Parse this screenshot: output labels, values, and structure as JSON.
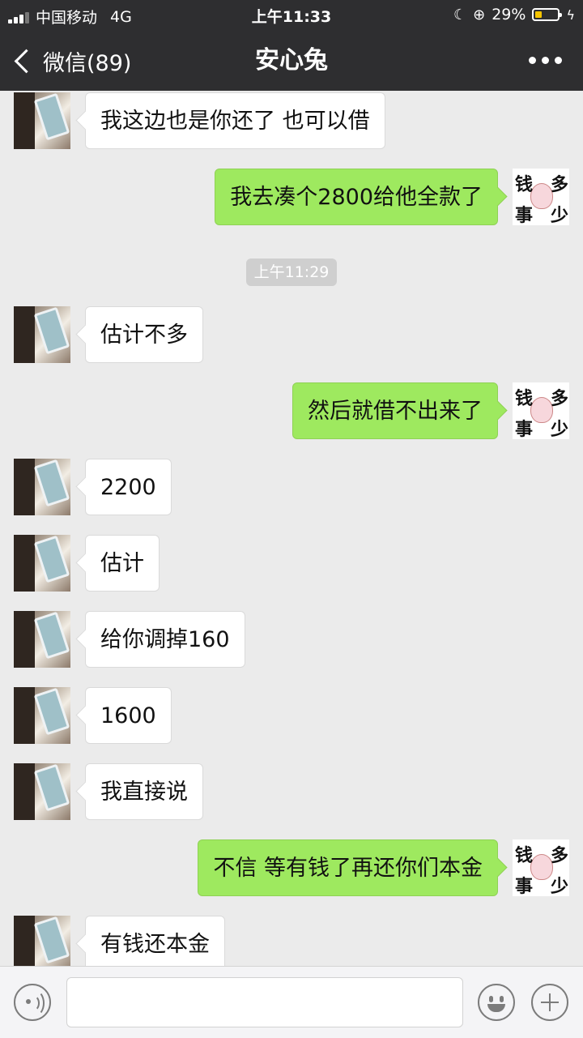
{
  "status_bar": {
    "carrier": "中国移动",
    "network": "4G",
    "time": "上午11:33",
    "battery_percent": "29%",
    "battery_level": 0.29,
    "battery_color": "#f5c400"
  },
  "nav": {
    "back_label": "微信(89)",
    "title": "安心兔",
    "more_icon": "more-dots-icon"
  },
  "chat": {
    "timestamp": "上午11:29",
    "messages": [
      {
        "side": "in",
        "text": "我这边也是你还了 也可以借"
      },
      {
        "side": "out",
        "text": "我去凑个2800给他全款了"
      },
      {
        "side": "in",
        "text": "估计不多"
      },
      {
        "side": "out",
        "text": "然后就借不出来了"
      },
      {
        "side": "in",
        "text": "2200"
      },
      {
        "side": "in",
        "text": "估计"
      },
      {
        "side": "in",
        "text": "给你调掉160"
      },
      {
        "side": "in",
        "text": "1600"
      },
      {
        "side": "in",
        "text": "我直接说"
      },
      {
        "side": "out",
        "text": "不信  等有钱了再还你们本金"
      },
      {
        "side": "in",
        "text": "有钱还本金"
      }
    ],
    "sticker_avatar_text": [
      "钱",
      "多",
      "事",
      "少"
    ]
  },
  "input_bar": {
    "voice_icon": "voice-icon",
    "emoji_icon": "emoji-icon",
    "plus_icon": "plus-icon"
  },
  "colors": {
    "header_bg": "#2e2e30",
    "chat_bg": "#ebebeb",
    "outgoing_bubble": "#9ee95f",
    "incoming_bubble": "#ffffff"
  }
}
